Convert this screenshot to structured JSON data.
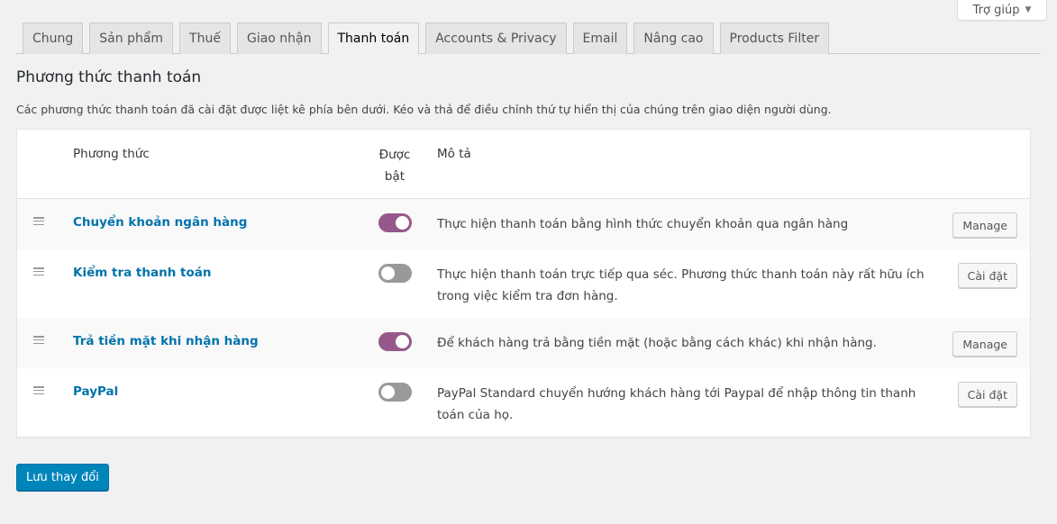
{
  "help": {
    "label": "Trợ giúp"
  },
  "tabs": [
    {
      "label": "Chung"
    },
    {
      "label": "Sản phẩm"
    },
    {
      "label": "Thuế"
    },
    {
      "label": "Giao nhận"
    },
    {
      "label": "Thanh toán",
      "active": true
    },
    {
      "label": "Accounts & Privacy"
    },
    {
      "label": "Email"
    },
    {
      "label": "Nâng cao"
    },
    {
      "label": "Products Filter"
    }
  ],
  "section": {
    "title": "Phương thức thanh toán",
    "description": "Các phương thức thanh toán đã cài đặt được liệt kê phía bên dưới. Kéo và thả để điều chỉnh thứ tự hiển thị của chúng trên giao diện người dùng."
  },
  "table": {
    "headers": {
      "method": "Phương thức",
      "enabled_line1": "Được",
      "enabled_line2": "bật",
      "description": "Mô tả"
    },
    "rows": [
      {
        "name": "Chuyển khoản ngân hàng",
        "enabled": true,
        "description": "Thực hiện thanh toán bằng hình thức chuyển khoản qua ngân hàng",
        "action": "Manage"
      },
      {
        "name": "Kiểm tra thanh toán",
        "enabled": false,
        "description": "Thực hiện thanh toán trực tiếp qua séc. Phương thức thanh toán này rất hữu ích trong việc kiểm tra đơn hàng.",
        "action": "Cài đặt"
      },
      {
        "name": "Trả tiền mặt khi nhận hàng",
        "enabled": true,
        "description": "Để khách hàng trả bằng tiền mặt (hoặc bằng cách khác) khi nhận hàng.",
        "action": "Manage"
      },
      {
        "name": "PayPal",
        "enabled": false,
        "description": "PayPal Standard chuyển hướng khách hàng tới Paypal để nhập thông tin thanh toán của họ.",
        "action": "Cài đặt"
      }
    ]
  },
  "save_label": "Lưu thay đổi",
  "colors": {
    "toggle_on": "#96588a",
    "toggle_off": "#999999",
    "link": "#0073aa",
    "primary_button": "#0085ba"
  }
}
